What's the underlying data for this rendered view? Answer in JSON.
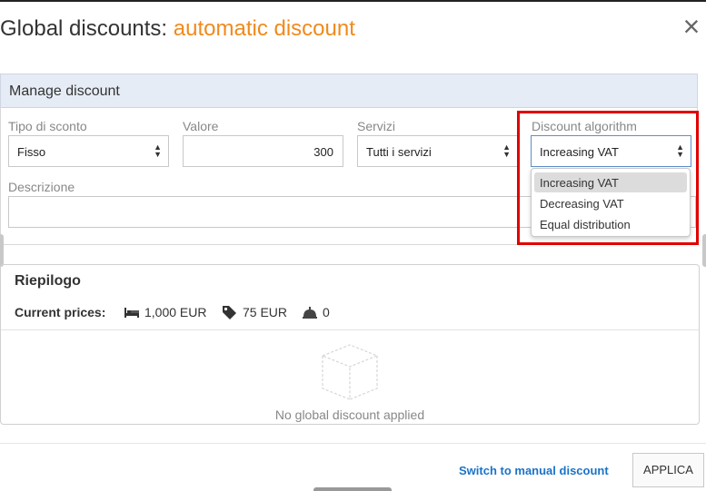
{
  "dialog": {
    "title_prefix": "Global discounts:",
    "title_accent": "automatic discount",
    "close_symbol": "×"
  },
  "manage": {
    "header": "Manage discount",
    "tipo_label": "Tipo di sconto",
    "tipo_value": "Fisso",
    "valore_label": "Valore",
    "valore_value": "300",
    "servizi_label": "Servizi",
    "servizi_value": "Tutti i servizi",
    "algorithm_label": "Discount algorithm",
    "algorithm_value": "Increasing VAT",
    "algorithm_options": [
      "Increasing VAT",
      "Decreasing VAT",
      "Equal distribution"
    ],
    "descrizione_label": "Descrizione",
    "descrizione_value": ""
  },
  "summary": {
    "title": "Riepilogo",
    "prices_label": "Current prices:",
    "room_price": "1,000 EUR",
    "extras_price": "75 EUR",
    "services_count": "0",
    "empty_text": "No global discount applied"
  },
  "footer": {
    "switch_link": "Switch to manual discount",
    "apply_button": "APPLICA"
  },
  "colors": {
    "accent": "#f08a1c",
    "link": "#1a73c8",
    "highlight": "#e00000",
    "header_bg": "#e6ecf5"
  },
  "icons": [
    "close-icon",
    "select-arrows-icon",
    "bed-icon",
    "tag-icon",
    "service-bell-icon",
    "empty-box-icon"
  ]
}
